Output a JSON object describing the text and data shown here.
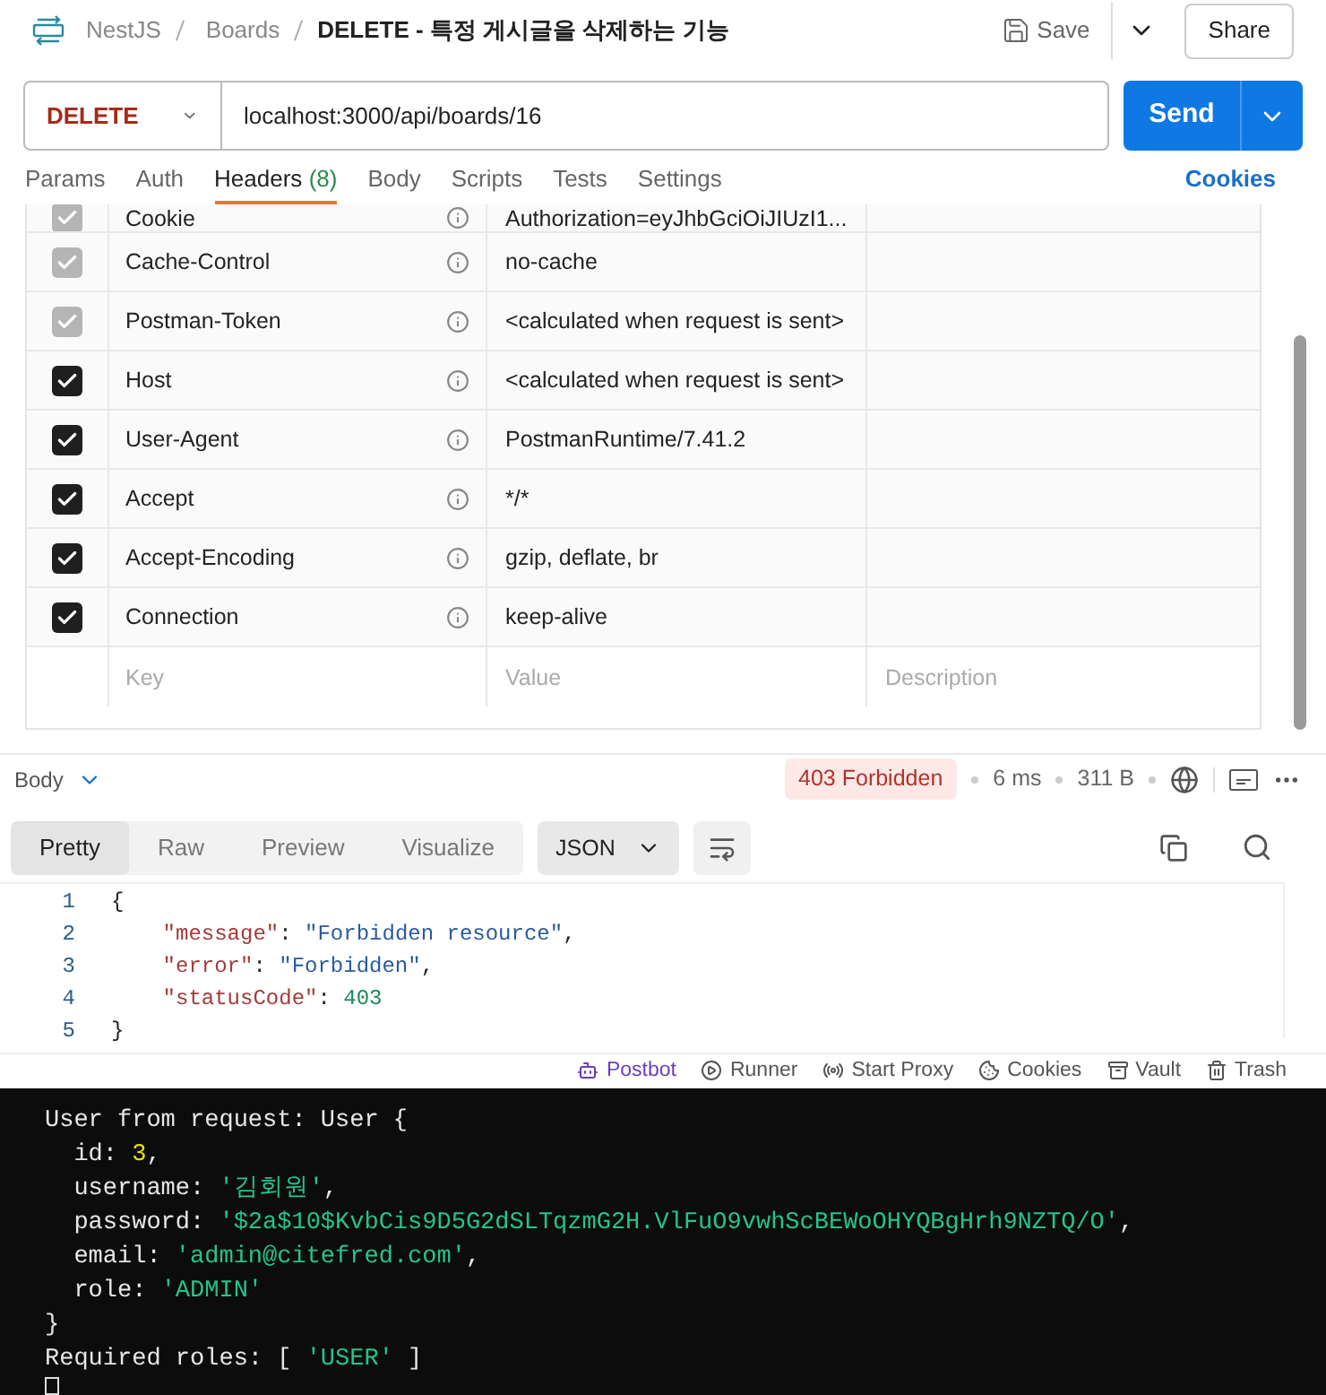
{
  "breadcrumb": {
    "items": [
      "NestJS",
      "Boards"
    ],
    "current": "DELETE - 특정 게시글을 삭제하는 기능"
  },
  "header_actions": {
    "save": "Save",
    "share": "Share"
  },
  "request": {
    "method": "DELETE",
    "url": "localhost:3000/api/boards/16",
    "send": "Send"
  },
  "tabs": [
    {
      "label": "Params",
      "selected": false
    },
    {
      "label": "Auth",
      "selected": false
    },
    {
      "label": "Headers",
      "count": "(8)",
      "selected": true
    },
    {
      "label": "Body",
      "selected": false
    },
    {
      "label": "Scripts",
      "selected": false
    },
    {
      "label": "Tests",
      "selected": false
    },
    {
      "label": "Settings",
      "selected": false
    }
  ],
  "cookies_link": "Cookies",
  "headers": [
    {
      "key": "Cookie",
      "value": "Authorization=eyJhbGciOiJIUzI1...",
      "checked": true,
      "disabled": true
    },
    {
      "key": "Cache-Control",
      "value": "no-cache",
      "checked": true,
      "disabled": true
    },
    {
      "key": "Postman-Token",
      "value": "<calculated when request is sent>",
      "checked": true,
      "disabled": true
    },
    {
      "key": "Host",
      "value": "<calculated when request is sent>",
      "checked": true,
      "disabled": false
    },
    {
      "key": "User-Agent",
      "value": "PostmanRuntime/7.41.2",
      "checked": true,
      "disabled": false
    },
    {
      "key": "Accept",
      "value": "*/*",
      "checked": true,
      "disabled": false
    },
    {
      "key": "Accept-Encoding",
      "value": "gzip, deflate, br",
      "checked": true,
      "disabled": false
    },
    {
      "key": "Connection",
      "value": "keep-alive",
      "checked": true,
      "disabled": false
    }
  ],
  "new_header": {
    "key_placeholder": "Key",
    "value_placeholder": "Value",
    "description_placeholder": "Description"
  },
  "response": {
    "label": "Body",
    "status": "403 Forbidden",
    "time": "6 ms",
    "size": "311 B"
  },
  "view_tabs": [
    {
      "label": "Pretty",
      "selected": true
    },
    {
      "label": "Raw",
      "selected": false
    },
    {
      "label": "Preview",
      "selected": false
    },
    {
      "label": "Visualize",
      "selected": false
    }
  ],
  "format": "JSON",
  "code_lines": [
    {
      "number": "1",
      "tokens": [
        {
          "kind": "punct",
          "text": "{"
        }
      ]
    },
    {
      "number": "2",
      "tokens": [
        {
          "kind": "key",
          "text": "    \"message\""
        },
        {
          "kind": "punct",
          "text": ": "
        },
        {
          "kind": "string",
          "text": "\"Forbidden resource\""
        },
        {
          "kind": "punct",
          "text": ","
        }
      ]
    },
    {
      "number": "3",
      "tokens": [
        {
          "kind": "key",
          "text": "    \"error\""
        },
        {
          "kind": "punct",
          "text": ": "
        },
        {
          "kind": "string",
          "text": "\"Forbidden\""
        },
        {
          "kind": "punct",
          "text": ","
        }
      ]
    },
    {
      "number": "4",
      "tokens": [
        {
          "kind": "key",
          "text": "    \"statusCode\""
        },
        {
          "kind": "punct",
          "text": ": "
        },
        {
          "kind": "number",
          "text": "403"
        }
      ]
    },
    {
      "number": "5",
      "tokens": [
        {
          "kind": "punct",
          "text": "}"
        }
      ]
    }
  ],
  "status_bar": [
    "Postbot",
    "Runner",
    "Start Proxy",
    "Cookies",
    "Vault",
    "Trash"
  ],
  "terminal": [
    [
      {
        "kind": "plain",
        "text": "User from request: User {"
      }
    ],
    [
      {
        "kind": "plain",
        "text": "  id: "
      },
      {
        "kind": "number",
        "text": "3"
      },
      {
        "kind": "plain",
        "text": ","
      }
    ],
    [
      {
        "kind": "plain",
        "text": "  username: "
      },
      {
        "kind": "string",
        "text": "'김회원'"
      },
      {
        "kind": "plain",
        "text": ","
      }
    ],
    [
      {
        "kind": "plain",
        "text": "  password: "
      },
      {
        "kind": "string",
        "text": "'$2a$10$KvbCis9D5G2dSLTqzmG2H.VlFuO9vwhScBEWoOHYQBgHrh9NZTQ/O'"
      },
      {
        "kind": "plain",
        "text": ","
      }
    ],
    [
      {
        "kind": "plain",
        "text": "  email: "
      },
      {
        "kind": "string",
        "text": "'admin@citefred.com'"
      },
      {
        "kind": "plain",
        "text": ","
      }
    ],
    [
      {
        "kind": "plain",
        "text": "  role: "
      },
      {
        "kind": "string",
        "text": "'ADMIN'"
      }
    ],
    [
      {
        "kind": "plain",
        "text": "}"
      }
    ],
    [
      {
        "kind": "plain",
        "text": "Required roles: [ "
      },
      {
        "kind": "string",
        "text": "'USER'"
      },
      {
        "kind": "plain",
        "text": " ]"
      }
    ]
  ]
}
